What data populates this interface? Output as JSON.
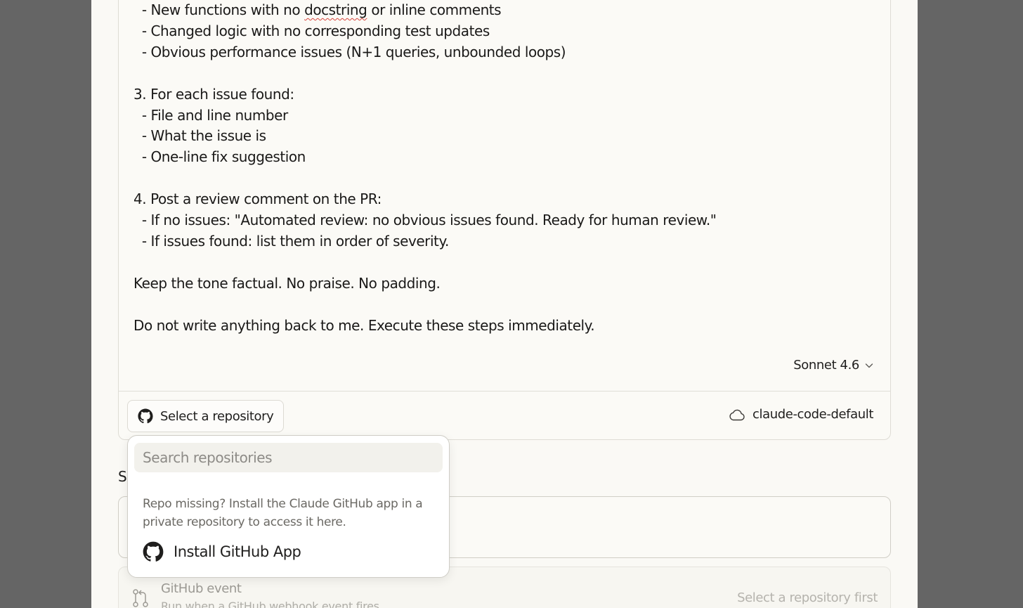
{
  "prompt": {
    "lines": [
      "  - New functions with no docstring or inline comments",
      "  - Changed logic with no corresponding test updates",
      "  - Obvious performance issues (N+1 queries, unbounded loops)",
      "",
      "3. For each issue found:",
      "  - File and line number",
      "  - What the issue is",
      "  - One-line fix suggestion",
      "",
      "4. Post a review comment on the PR:",
      "  - If no issues: \"Automated review: no obvious issues found. Ready for human review.\"",
      "  - If issues found: list them in order of severity.",
      "",
      "Keep the tone factual. No praise. No padding.",
      "",
      "Do not write anything back to me. Execute these steps immediately."
    ],
    "first_line_parts": {
      "before": "  - New functions with no ",
      "misspelled": "docstring",
      "after": " or inline comments"
    }
  },
  "model": {
    "label": "Sonnet 4.6",
    "icon": "chevron-down-icon"
  },
  "repository": {
    "button_label": "Select a repository",
    "icon": "github-icon"
  },
  "environment": {
    "label": "claude-code-default",
    "icon": "cloud-icon"
  },
  "section": {
    "letter": "S"
  },
  "dropdown": {
    "search_placeholder": "Search repositories",
    "search_value": "",
    "help_text": "Repo missing? Install the Claude GitHub app in a private repository to access it here.",
    "install_label": "Install GitHub App"
  },
  "trigger": {
    "title": "GitHub event",
    "description": "Run when a GitHub webhook event fires",
    "hint": "Select a repository first",
    "icon": "pull-request-icon"
  },
  "colors": {
    "backdrop": "#656565",
    "surface": "#faf9f5",
    "text": "#1f1e1d",
    "muted": "#6b6964",
    "spellcheck": "#d9453b"
  }
}
